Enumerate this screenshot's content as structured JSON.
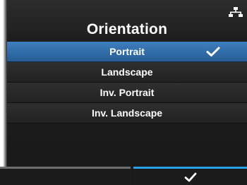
{
  "header": {
    "title": "Orientation",
    "network_icon": "network-icon"
  },
  "options": [
    {
      "label": "Portrait",
      "selected": true
    },
    {
      "label": "Landscape",
      "selected": false
    },
    {
      "label": "Inv. Portrait",
      "selected": false
    },
    {
      "label": "Inv. Landscape",
      "selected": false
    }
  ],
  "icons": {
    "selected_check": "check-icon",
    "confirm": "checkmark-icon"
  },
  "colors": {
    "selection": "#2f6aa6",
    "confirm_accent": "#2aa3e6",
    "inactive_accent": "#6e6e6e",
    "background": "#1c1c1c"
  }
}
